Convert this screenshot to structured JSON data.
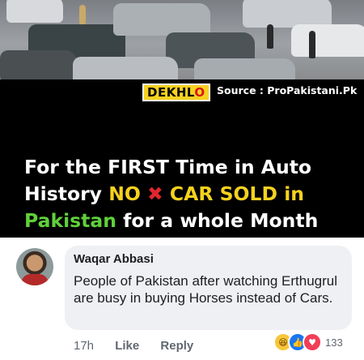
{
  "post": {
    "photo_description": "",
    "brand": {
      "part1": "DEKHL",
      "part2": "O"
    },
    "source": "Source : ProPakistani.Pk",
    "headline": {
      "line1": "For the FIRST Time in Auto",
      "line2_a": "History ",
      "line2_b": "NO",
      "line2_x": "✖",
      "line2_c": "CAR SOLD in",
      "line3_a": "Pakistan",
      "line3_b": " for a whole Month"
    },
    "colors": {
      "yellow": "#f6d21e",
      "green": "#5fd13a",
      "red": "#e0262d"
    }
  },
  "comment": {
    "author": "Waqar Abbasi",
    "text": "People of Pakistan after watching Erthugrul are busy in buying Horses instead of Cars.",
    "time": "17h",
    "like_label": "Like",
    "reply_label": "Reply",
    "reactions": {
      "icons": [
        "haha-icon",
        "like-icon",
        "love-icon"
      ],
      "count": "133"
    }
  }
}
